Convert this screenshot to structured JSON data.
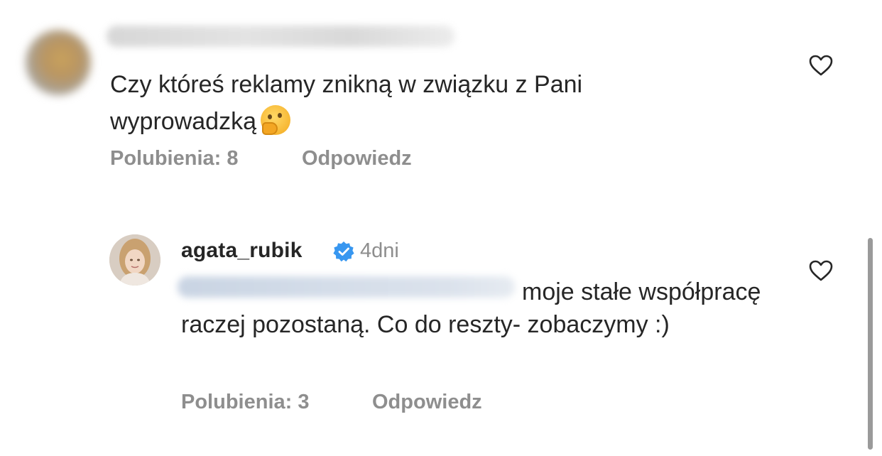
{
  "comments": [
    {
      "text_line1": "Czy któreś reklamy znikną w związku z Pani",
      "text_line2": "wyprowadzką",
      "emoji_icon": "thinking-face-icon",
      "likes_label": "Polubienia: 8",
      "reply_label": "Odpowiedz"
    },
    {
      "username": "agata_rubik",
      "time": "4dni",
      "text": "moje stałe współpracę raczej pozostaną. Co do reszty- zobaczymy :)",
      "likes_label": "Polubienia: 3",
      "reply_label": "Odpowiedz"
    }
  ],
  "colors": {
    "text": "#262626",
    "meta": "#8e8e8e",
    "verified": "#3897f0"
  }
}
